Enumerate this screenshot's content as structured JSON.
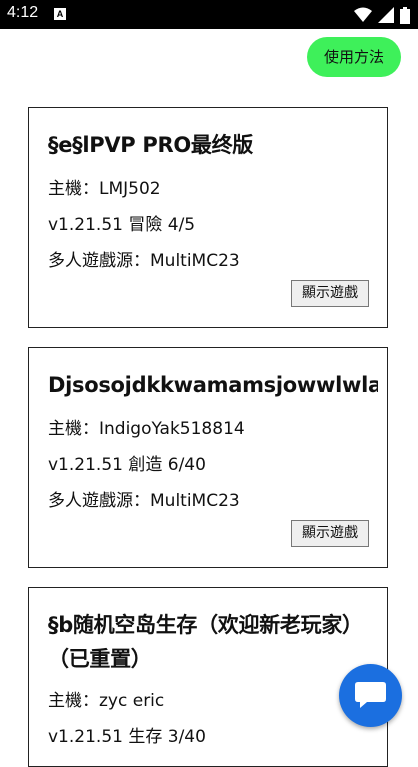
{
  "status_bar": {
    "time": "4:12",
    "notification_icon": "A",
    "icons": [
      "wifi-icon",
      "signal-icon",
      "battery-icon"
    ]
  },
  "usage_button": {
    "label": "使用方法",
    "color": "#3ef05a"
  },
  "cards": [
    {
      "title": "§e§lPVP PRO最终版",
      "host": "主機：LMJ502",
      "mode": "v1.21.51 冒險 4/5",
      "source": "多人遊戲源：MultiMC23",
      "button": "顯示遊戲"
    },
    {
      "title": "Djsosojdkkwamamsjowwlwlals",
      "host": "主機：IndigoYak518814",
      "mode": "v1.21.51 創造 6/40",
      "source": "多人遊戲源：MultiMC23",
      "button": "顯示遊戲"
    },
    {
      "title": "§b随机空岛生存（欢迎新老玩家）（已重置）",
      "host": "主機：zyc eric",
      "mode": "v1.21.51 生存 3/40"
    }
  ],
  "fab": {
    "icon": "chat-icon",
    "color": "#1b6fe0"
  }
}
